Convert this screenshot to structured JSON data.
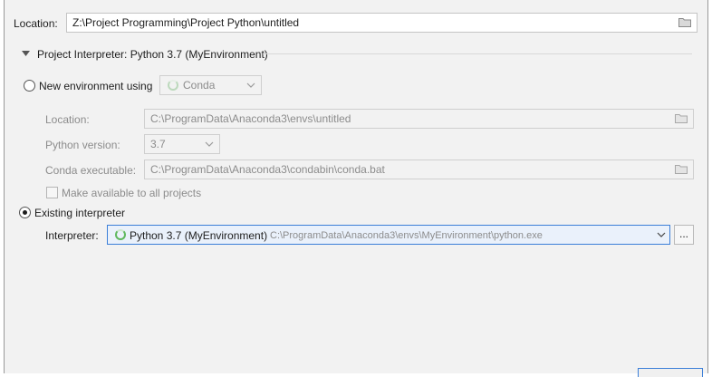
{
  "project": {
    "location_label": "Location:",
    "location_value": "Z:\\Project Programming\\Project Python\\untitled"
  },
  "interpreter_section": {
    "title": "Project Interpreter: Python 3.7 (MyEnvironment)"
  },
  "new_environment": {
    "radio_label": "New environment using",
    "tool_value": "Conda",
    "location_label": "Location:",
    "location_value": "C:\\ProgramData\\Anaconda3\\envs\\untitled",
    "python_version_label": "Python version:",
    "python_version_value": "3.7",
    "conda_exec_label": "Conda executable:",
    "conda_exec_value": "C:\\ProgramData\\Anaconda3\\condabin\\conda.bat",
    "make_available_label": "Make available to all projects"
  },
  "existing": {
    "radio_label": "Existing interpreter",
    "interpreter_label": "Interpreter:",
    "interpreter_name": "Python 3.7 (MyEnvironment)",
    "interpreter_path": "C:\\ProgramData\\Anaconda3\\envs\\MyEnvironment\\python.exe",
    "browse_label": "..."
  },
  "icons": {
    "folder": "folder-icon",
    "chevron": "chevron-down-icon",
    "triangle": "triangle-down-icon",
    "spinner": "conda-spinner-icon"
  },
  "colors": {
    "dialog_bg": "#f2f2f2",
    "selected_field_border": "#3c7fd8",
    "selected_field_bg": "#eaf1fb",
    "disabled_text": "#8c8c8c"
  }
}
